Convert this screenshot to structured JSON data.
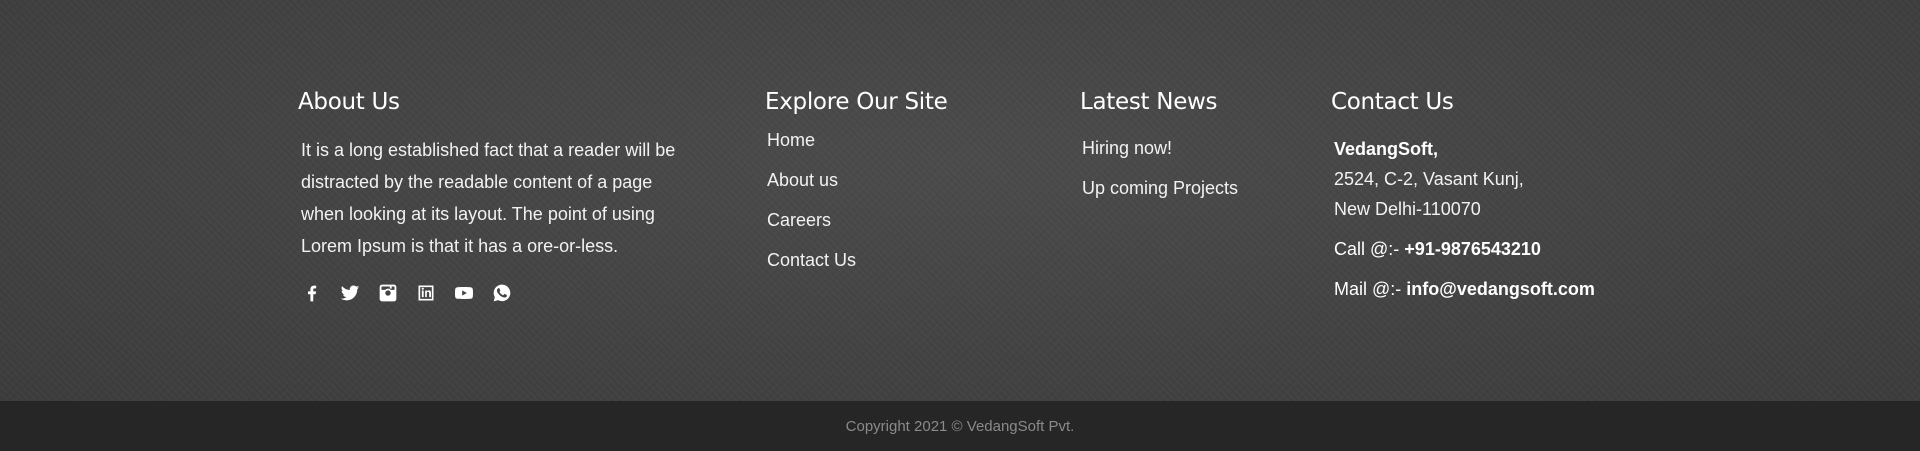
{
  "about": {
    "title": "About Us",
    "text": "It is a long established fact that a reader will be distracted by the readable content of a page when looking at its layout. The point of using Lorem Ipsum is that it has a ore-or-less."
  },
  "social": [
    "facebook-icon",
    "twitter-icon",
    "instagram-icon",
    "linkedin-icon",
    "youtube-icon",
    "whatsapp-icon"
  ],
  "explore": {
    "title": "Explore Our Site",
    "links": [
      "Home",
      "About us",
      "Careers",
      "Contact Us"
    ]
  },
  "news": {
    "title": "Latest News",
    "items": [
      "Hiring now!",
      "Up coming Projects"
    ]
  },
  "contact": {
    "title": "Contact Us",
    "company": "VedangSoft,",
    "address_line1": "2524, C-2, Vasant Kunj,",
    "address_line2": "New Delhi-110070",
    "phone_label": "Call @:-",
    "phone": "+91-9876543210",
    "mail_label": "Mail @:-",
    "mail": "info@vedangsoft.com"
  },
  "copyright": "Copyright 2021 © VedangSoft Pvt."
}
